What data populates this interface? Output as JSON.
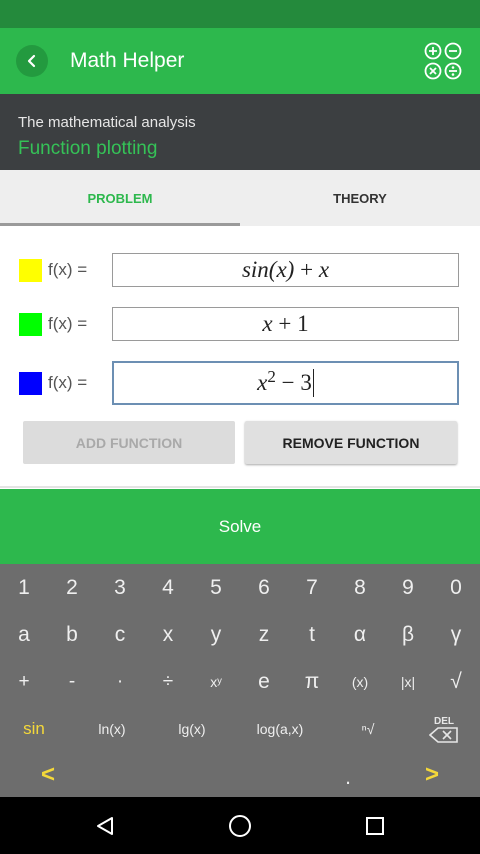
{
  "app": {
    "title": "Math Helper"
  },
  "header": {
    "subtitle": "The mathematical analysis",
    "title": "Function plotting"
  },
  "tabs": [
    {
      "label": "PROBLEM",
      "active": true
    },
    {
      "label": "THEORY",
      "active": false
    }
  ],
  "functions": [
    {
      "color": "#ffff00",
      "label": "f(x) =",
      "expr_a": "sin(x)",
      "expr_b": " + ",
      "expr_c": "x"
    },
    {
      "color": "#00ff00",
      "label": "f(x) =",
      "expr_a": "x",
      "expr_b": " + 1",
      "expr_c": ""
    },
    {
      "color": "#0000ff",
      "label": "f(x) =",
      "expr_base": "x",
      "expr_exp": "2",
      "expr_rest": " − 3"
    }
  ],
  "buttons": {
    "add": "ADD FUNCTION",
    "remove": "REMOVE FUNCTION",
    "solve": "Solve"
  },
  "keyboard": {
    "row1": [
      "1",
      "2",
      "3",
      "4",
      "5",
      "6",
      "7",
      "8",
      "9",
      "0"
    ],
    "row2": [
      "a",
      "b",
      "c",
      "x",
      "y",
      "z",
      "t",
      "α",
      "β",
      "γ"
    ],
    "row3": [
      "+",
      "-",
      "·",
      "÷",
      "xʸ",
      "e",
      "π",
      "(x)",
      "|x|",
      "√"
    ],
    "row4": [
      "sin",
      "ln(x)",
      "lg(x)",
      "log(a,x)",
      "ⁿ√",
      "DEL"
    ],
    "row5": [
      "<",
      ".",
      ">"
    ]
  },
  "colors": {
    "accent": "#2db84d",
    "keyboard_bg": "#6d6d6d",
    "highlight": "#f4d83a"
  },
  "icons": {
    "back": "chevron-left-icon",
    "operations": "math-operations-icon",
    "delete": "backspace-icon"
  }
}
